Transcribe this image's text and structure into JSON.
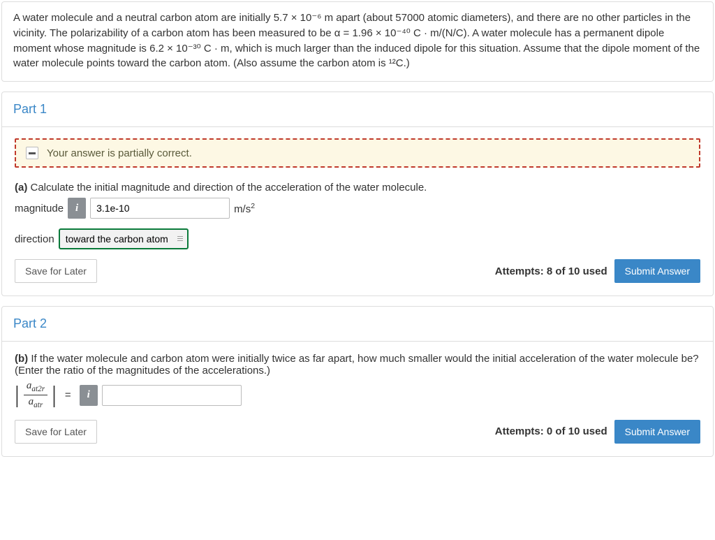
{
  "problem": {
    "text_before_alpha": "A water molecule and a neutral carbon atom are initially 5.7 × 10⁻⁶ m apart (about 57000 atomic diameters), and there are no other particles in the vicinity. The polarizability of a carbon atom has been measured to be α =  1.96 × 10⁻⁴⁰ C · m/(N/C). A water molecule has a permanent dipole moment whose magnitude is 6.2 × 10⁻³⁰ C · m, which is much larger than the induced dipole for this situation. Assume that the dipole moment of the water molecule points toward the carbon atom. (Also assume the carbon atom is ¹²C.)"
  },
  "part1": {
    "title": "Part 1",
    "feedback": "Your answer is partially correct.",
    "prompt_label": "(a)",
    "prompt_text": " Calculate the initial magnitude and direction of the acceleration of the water molecule.",
    "magnitude_label": "magnitude",
    "magnitude_value": "3.1e-10",
    "magnitude_unit_html": "m/s²",
    "direction_label": "direction",
    "direction_selected": "toward the carbon atom",
    "save_label": "Save for Later",
    "attempts_text": "Attempts: 8 of 10 used",
    "submit_label": "Submit Answer"
  },
  "part2": {
    "title": "Part 2",
    "prompt_label": "(b)",
    "prompt_text": " If the water molecule and carbon atom were initially twice as far apart, how much smaller would the initial acceleration of the water molecule be? (Enter the ratio of the magnitudes of the accelerations.)",
    "frac_top": "a",
    "frac_top_sub": "at2r",
    "frac_bot": "a",
    "frac_bot_sub": "atr",
    "equals": "=",
    "ratio_value": "",
    "save_label": "Save for Later",
    "attempts_text": "Attempts: 0 of 10 used",
    "submit_label": "Submit Answer"
  }
}
